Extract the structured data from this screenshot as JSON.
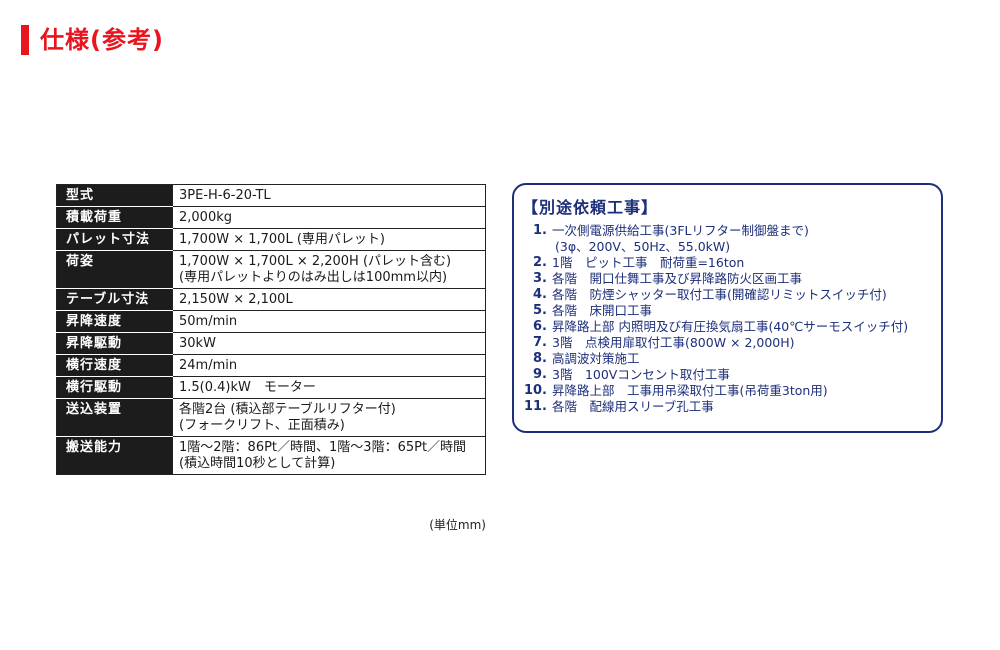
{
  "header": {
    "title": "仕様(参考)"
  },
  "spec_table": {
    "rows": [
      {
        "label": "型式",
        "value": "3PE-H-6-20-TL",
        "value2": ""
      },
      {
        "label": "積載荷重",
        "value": "2,000kg",
        "value2": ""
      },
      {
        "label": "パレット寸法",
        "value": "1,700W × 1,700L (専用パレット)",
        "value2": ""
      },
      {
        "label": "荷姿",
        "value": "1,700W × 1,700L × 2,200H (パレット含む)",
        "value2": "(専用パレットよりのはみ出しは100mm以内)"
      },
      {
        "label": "テーブル寸法",
        "value": "2,150W × 2,100L",
        "value2": ""
      },
      {
        "label": "昇降速度",
        "value": "50m/min",
        "value2": ""
      },
      {
        "label": "昇降駆動",
        "value": "30kW",
        "value2": ""
      },
      {
        "label": "横行速度",
        "value": "24m/min",
        "value2": ""
      },
      {
        "label": "横行駆動",
        "value": "1.5(0.4)kW　モーター",
        "value2": ""
      },
      {
        "label": "送込装置",
        "value": "各階2台 (積込部テーブルリフター付)",
        "value2": "(フォークリフト、正面積み)"
      },
      {
        "label": "搬送能力",
        "value": "1階〜2階：86Pt／時間、1階〜3階：65Pt／時間",
        "value2": "(積込時間10秒として計算)"
      }
    ],
    "unit_note": "(単位mm)"
  },
  "side_box": {
    "title": "【別途依頼工事】",
    "items": [
      {
        "num": "1.",
        "text": "一次側電源供給工事(3FLリフター制御盤まで)"
      },
      {
        "num": "",
        "text": "(3φ、200V、50Hz、55.0kW)"
      },
      {
        "num": "2.",
        "text": "1階　ピット工事　耐荷重=16ton"
      },
      {
        "num": "3.",
        "text": "各階　開口仕舞工事及び昇降路防火区画工事"
      },
      {
        "num": "4.",
        "text": "各階　防煙シャッター取付工事(開確認リミットスイッチ付)"
      },
      {
        "num": "5.",
        "text": "各階　床開口工事"
      },
      {
        "num": "6.",
        "text": "昇降路上部 内照明及び有圧換気扇工事(40℃サーモスイッチ付)"
      },
      {
        "num": "7.",
        "text": "3階　点検用扉取付工事(800W × 2,000H)"
      },
      {
        "num": "8.",
        "text": "高調波対策施工"
      },
      {
        "num": "9.",
        "text": "3階　100Vコンセント取付工事"
      },
      {
        "num": "10.",
        "text": "昇降路上部　工事用吊梁取付工事(吊荷重3ton用)"
      },
      {
        "num": "11.",
        "text": "各階　配線用スリーブ孔工事"
      }
    ]
  },
  "colors": {
    "accent_red": "#e8141e",
    "navy": "#1d2f7a",
    "label_bg": "#1c1c1c"
  }
}
